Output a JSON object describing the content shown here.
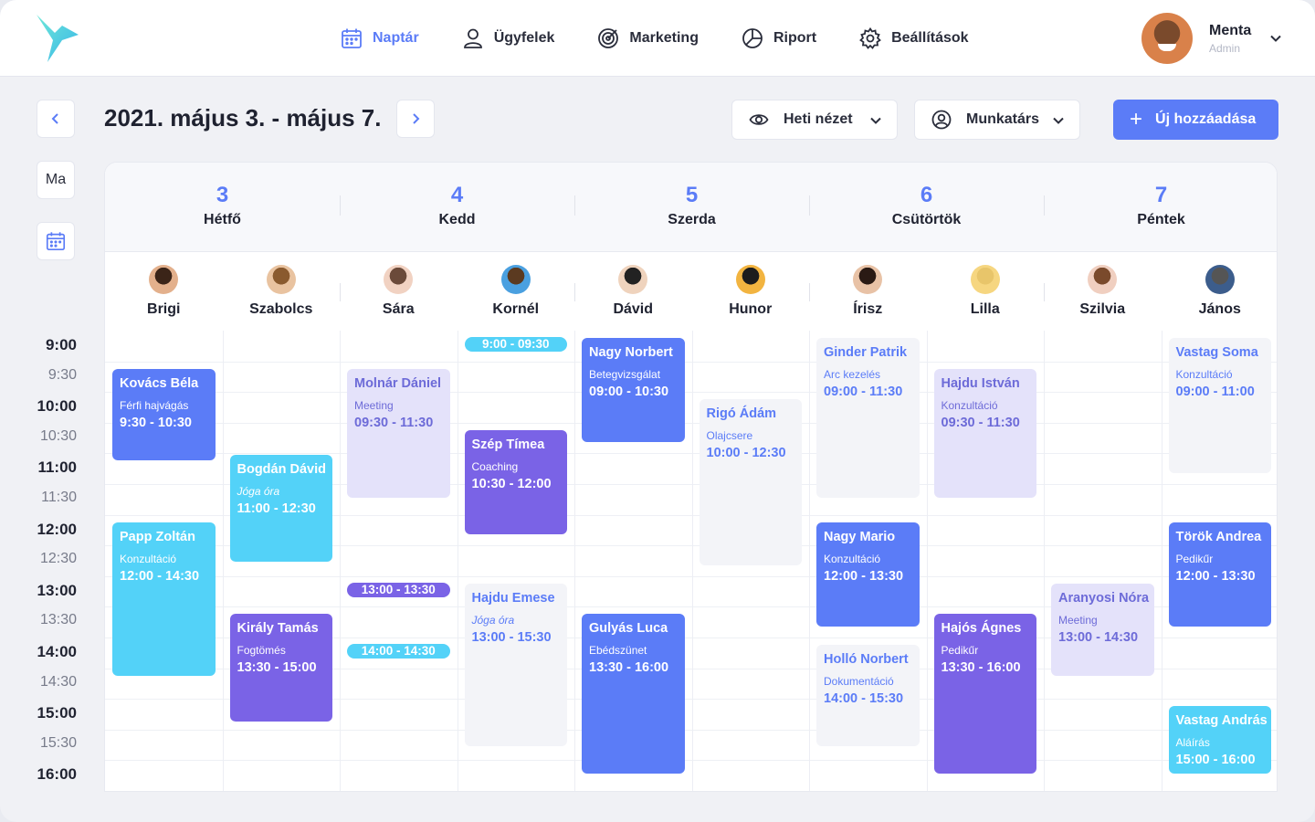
{
  "nav": {
    "items": [
      {
        "label": "Naptár",
        "icon": "calendar-icon",
        "active": true
      },
      {
        "label": "Ügyfelek",
        "icon": "user-icon"
      },
      {
        "label": "Marketing",
        "icon": "target-icon"
      },
      {
        "label": "Riport",
        "icon": "pie-chart-icon"
      },
      {
        "label": "Beállítások",
        "icon": "gear-icon"
      }
    ]
  },
  "user": {
    "name": "Menta",
    "role": "Admin"
  },
  "toolbar": {
    "date_range": "2021. május 3. - május 7.",
    "view_label": "Heti nézet",
    "staff_label": "Munkatárs",
    "add_label": "Új hozzáadása",
    "today_label": "Ma"
  },
  "times": [
    "9:00",
    "9:30",
    "10:00",
    "10:30",
    "11:00",
    "11:30",
    "12:00",
    "12:30",
    "13:00",
    "13:30",
    "14:00",
    "14:30",
    "15:00",
    "15:30",
    "16:00"
  ],
  "days": [
    {
      "num": "3",
      "name": "Hétfő"
    },
    {
      "num": "4",
      "name": "Kedd"
    },
    {
      "num": "5",
      "name": "Szerda"
    },
    {
      "num": "6",
      "name": "Csütörtök"
    },
    {
      "num": "7",
      "name": "Péntek"
    }
  ],
  "staff": [
    "Brigi",
    "Szabolcs",
    "Sára",
    "Kornél",
    "Dávid",
    "Hunor",
    "Írisz",
    "Lilla",
    "Szilvia",
    "János"
  ],
  "events": [
    {
      "col": 0,
      "start": 9.5,
      "end": 11,
      "name": "Kovács Béla",
      "type": "Férfi hajvágás",
      "time": "9:30 - 10:30",
      "color": "blue"
    },
    {
      "col": 0,
      "start": 12,
      "end": 14.5,
      "name": "Papp Zoltán",
      "type": "Konzultáció",
      "time": "12:00 - 14:30",
      "color": "cyan"
    },
    {
      "col": 1,
      "start": 10.9,
      "end": 12.65,
      "name": "Bogdán Dávid",
      "type": "Jóga óra",
      "time": "11:00 - 12:30",
      "color": "cyan"
    },
    {
      "col": 1,
      "start": 13.5,
      "end": 15.25,
      "name": "Király Tamás",
      "type": "Fogtömés",
      "time": "13:30 - 15:00",
      "color": "purple"
    },
    {
      "col": 2,
      "start": 9.5,
      "end": 11.6,
      "name": "Molnár Dániel",
      "type": "Meeting",
      "time": "09:30 - 11:30",
      "color": "lav"
    },
    {
      "col": 3,
      "start": 10.5,
      "end": 12.2,
      "name": "Szép Tímea",
      "type": "Coaching",
      "time": "10:30 - 12:00",
      "color": "purple"
    },
    {
      "col": 3,
      "start": 13,
      "end": 15.65,
      "name": "Hajdu Emese",
      "type": "Jóga óra",
      "time": "13:00 - 15:30",
      "color": "gray"
    },
    {
      "col": 4,
      "start": 9,
      "end": 10.7,
      "name": "Nagy Norbert",
      "type": "Betegvizsgálat",
      "time": "09:00 - 10:30",
      "color": "blue"
    },
    {
      "col": 4,
      "start": 13.5,
      "end": 16.1,
      "name": "Gulyás Luca",
      "type": "Ebédszünet",
      "time": "13:30 - 16:00",
      "color": "blue"
    },
    {
      "col": 5,
      "start": 10,
      "end": 12.7,
      "name": "Rigó Ádám",
      "type": "Olajcsere",
      "time": "10:00 - 12:30",
      "color": "gray"
    },
    {
      "col": 6,
      "start": 9,
      "end": 11.6,
      "name": "Ginder Patrik",
      "type": "Arc kezelés",
      "time": "09:00 - 11:30",
      "color": "gray"
    },
    {
      "col": 6,
      "start": 12,
      "end": 13.7,
      "name": "Nagy Mario",
      "type": "Konzultáció",
      "time": "12:00 - 13:30",
      "color": "blue"
    },
    {
      "col": 6,
      "start": 14,
      "end": 15.65,
      "name": "Holló Norbert",
      "type": "Dokumentáció",
      "time": "14:00 - 15:30",
      "color": "gray"
    },
    {
      "col": 7,
      "start": 9.5,
      "end": 11.6,
      "name": "Hajdu István",
      "type": "Konzultáció",
      "time": "09:30 - 11:30",
      "color": "lav"
    },
    {
      "col": 7,
      "start": 13.5,
      "end": 16.1,
      "name": "Hajós Ágnes",
      "type": "Pedikűr",
      "time": "13:30 - 16:00",
      "color": "purple"
    },
    {
      "col": 8,
      "start": 13,
      "end": 14.5,
      "name": "Aranyosi Nóra",
      "type": "Meeting",
      "time": "13:00 - 14:30",
      "color": "lav"
    },
    {
      "col": 9,
      "start": 9,
      "end": 11.2,
      "name": "Vastag Soma",
      "type": "Konzultáció",
      "time": "09:00 - 11:00",
      "color": "gray"
    },
    {
      "col": 9,
      "start": 12,
      "end": 13.7,
      "name": "Török Andrea",
      "type": "Pedikűr",
      "time": "12:00 - 13:30",
      "color": "blue"
    },
    {
      "col": 9,
      "start": 15,
      "end": 16.1,
      "name": "Vastag András",
      "type": "Aláírás",
      "time": "15:00 - 16:00",
      "color": "cyan"
    }
  ],
  "pills": [
    {
      "col": 3,
      "at": 9,
      "label": "9:00 - 09:30",
      "color": "#53d2f8"
    },
    {
      "col": 2,
      "at": 13,
      "label": "13:00 - 13:30",
      "color": "#7a63e6"
    },
    {
      "col": 2,
      "at": 14,
      "label": "14:00 - 14:30",
      "color": "#53d2f8"
    }
  ],
  "colors": {
    "accent": "#5b7cf7",
    "cyan": "#53d2f8",
    "purple": "#7a63e6",
    "lavender": "#e4e2fa"
  }
}
